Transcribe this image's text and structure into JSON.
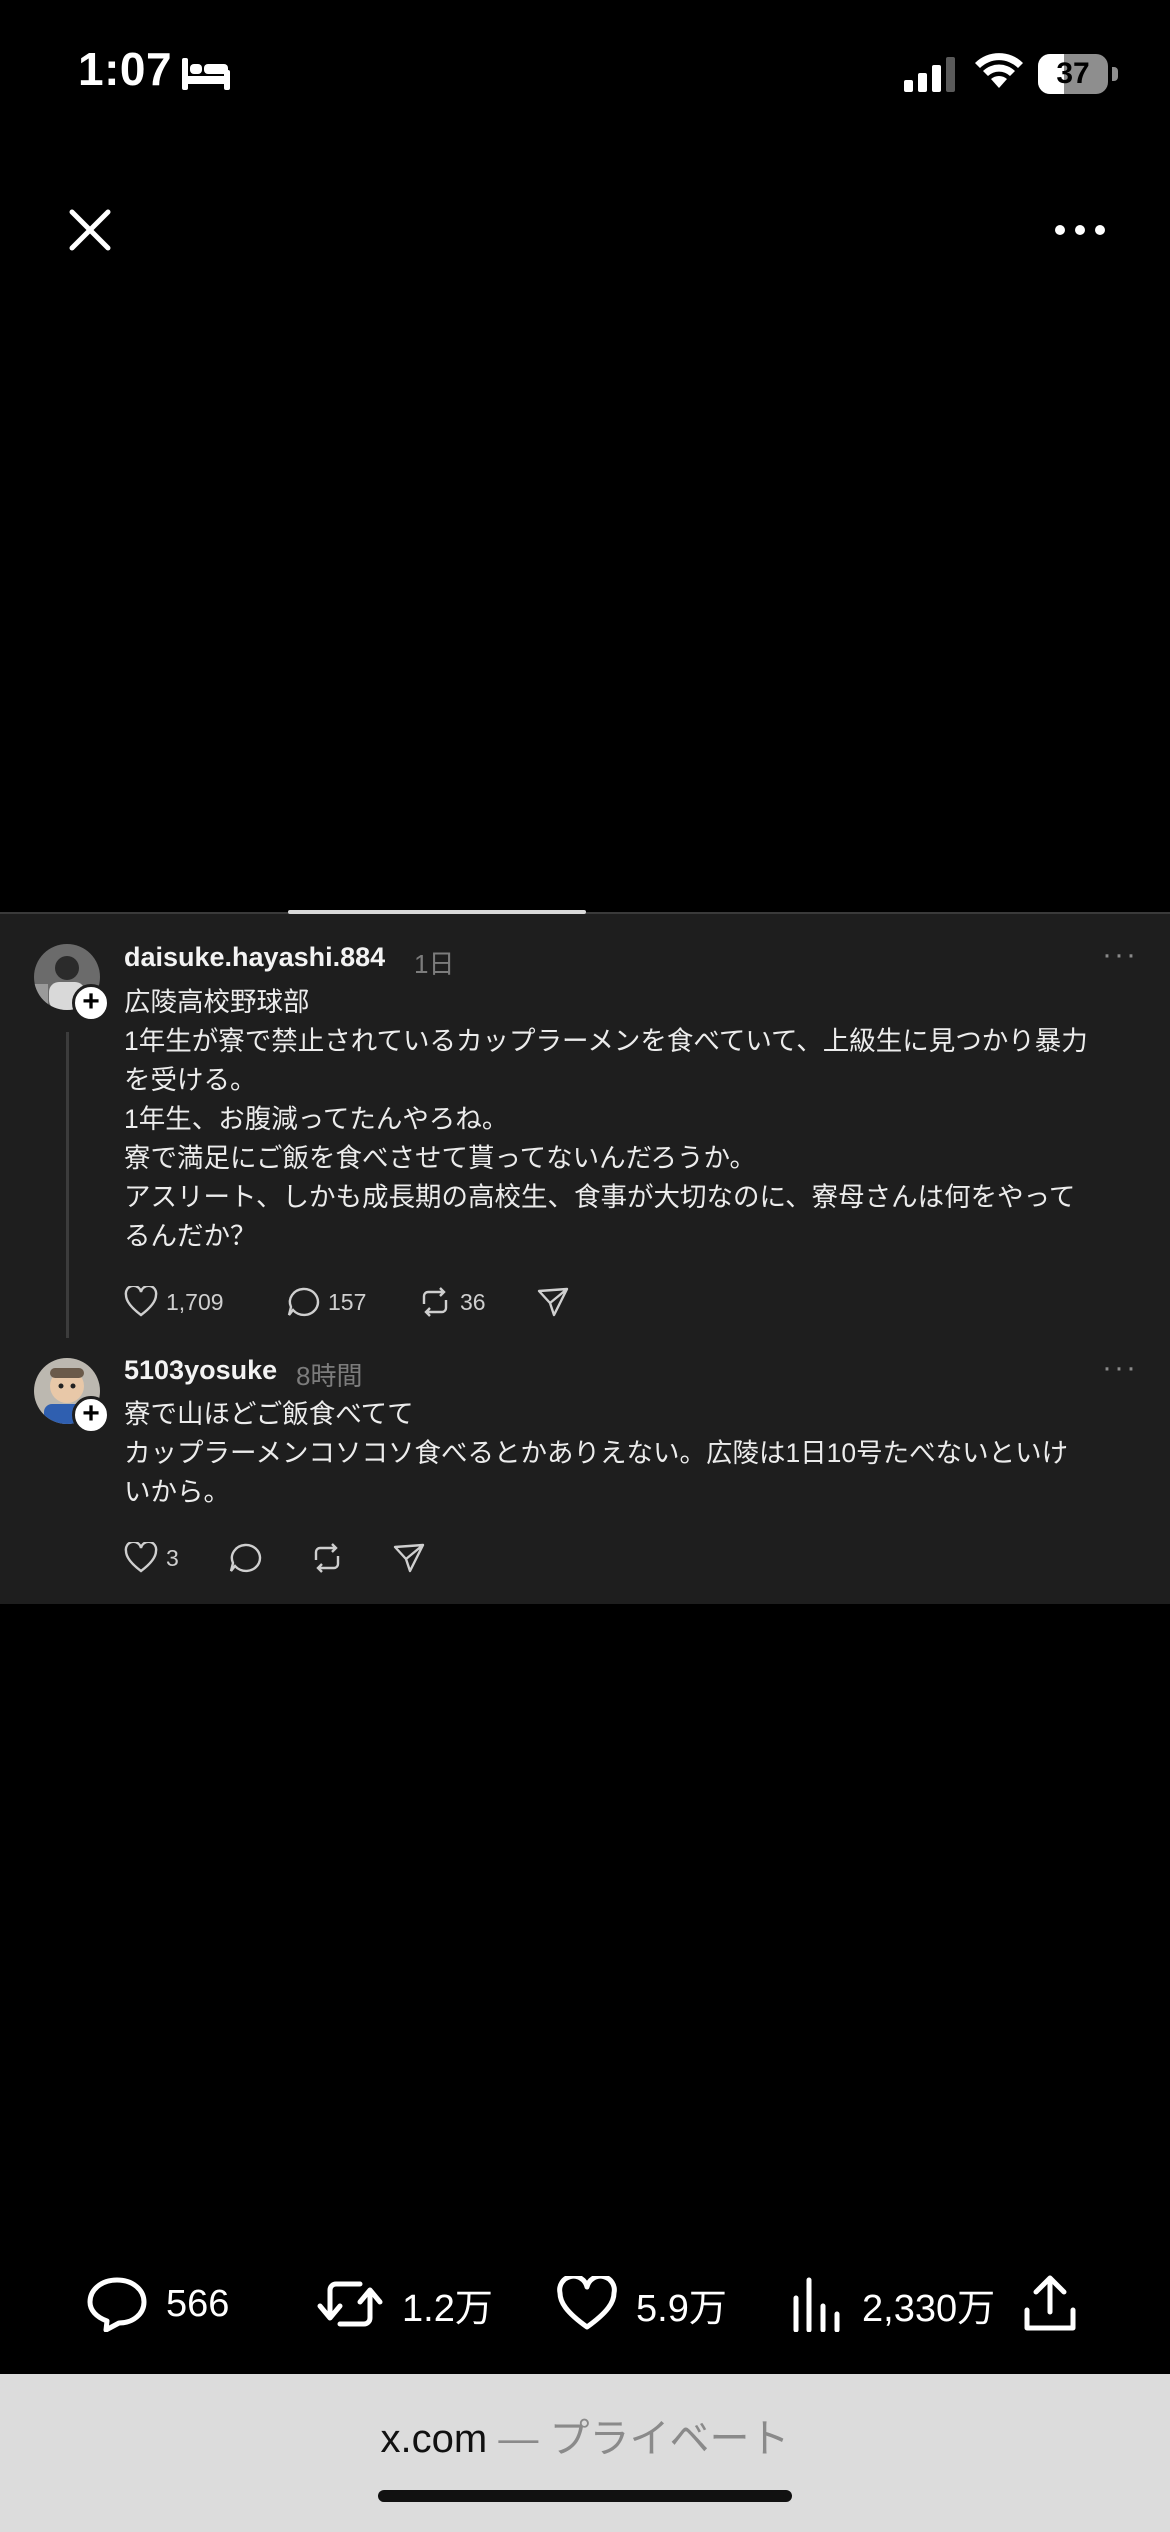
{
  "status_bar": {
    "time": "1:07",
    "battery_level": "37",
    "battery_fraction": 0.37
  },
  "viewer": {
    "close_icon": "close-icon",
    "more_icon": "more-horizontal-icon"
  },
  "thread": {
    "posts": [
      {
        "username": "daisuke.hayashi.884",
        "time": "1日",
        "text": "広陵高校野球部\n1年生が寮で禁止されているカップラーメンを食べていて、上級生に見つかり暴力\nを受ける。\n1年生、お腹減ってたんやろね。\n寮で満足にご飯を食べさせて貰ってないんだろうか。\nアスリート、しかも成長期の高校生、食事が大切なのに、寮母さんは何をやって\nるんだか？",
        "likes": "1,709",
        "comments": "157",
        "reposts": "36"
      },
      {
        "username": "5103yosuke",
        "time": "8時間",
        "text": "寮で山ほどご飯食べてて\nカップラーメンコソコソ食べるとかありえない。広陵は1日10号たべないといけ\nいから。",
        "likes": "3"
      }
    ]
  },
  "stats": {
    "replies": "566",
    "reposts": "1.2万",
    "likes": "5.9万",
    "views": "2,330万"
  },
  "browser": {
    "domain": "x.com",
    "separator": " — ",
    "mode": "プライベート"
  },
  "colors": {
    "background": "#000000",
    "card": "#1e1e1e",
    "safari_bar": "#dcdcdc"
  }
}
